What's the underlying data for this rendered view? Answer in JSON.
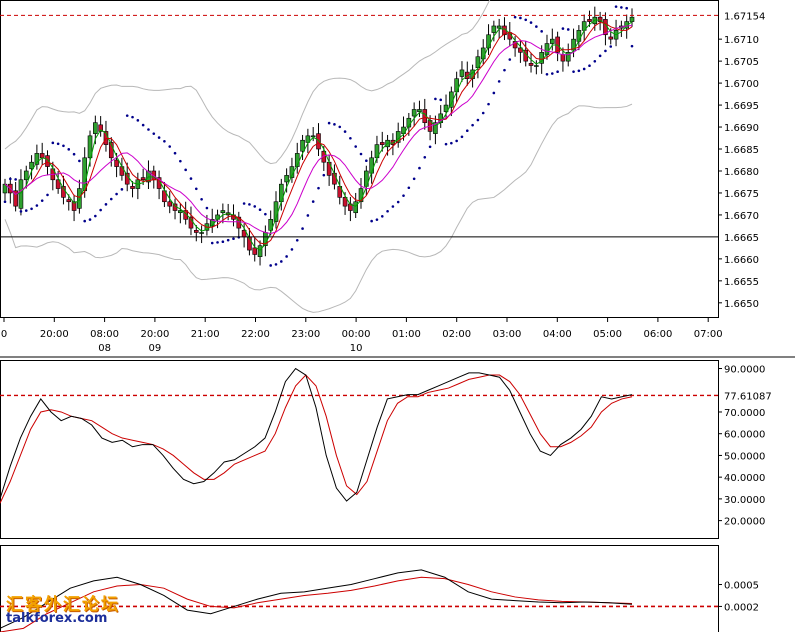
{
  "colors": {
    "bull_body": "#2ea02e",
    "bear_body": "#c8102e",
    "wick": "#000000",
    "bollinger": "#b8b8b8",
    "ma_fast": "#cc0000",
    "ma_slow": "#cc00cc",
    "ma_green": "#00a000",
    "sar": "#00008b",
    "hline": "#000000",
    "dashed_level": "#cc0000",
    "stoch_main": "#000000",
    "stoch_signal": "#cc0000",
    "level_text_blue": "#0000cc"
  },
  "logo": {
    "cn": "汇客外汇论坛",
    "en": "talkforex.com"
  },
  "chart_data": [
    {
      "type": "candlestick",
      "ylim": [
        1.6647,
        1.6718
      ],
      "price_ticks": [
        "1.6710",
        "1.6705",
        "1.6700",
        "1.6695",
        "1.6690",
        "1.6685",
        "1.6680",
        "1.6675",
        "1.6670",
        "1.6660",
        "1.6655",
        "1.6650"
      ],
      "current_price_label": "1.67154",
      "current_price": 1.67154,
      "horizontal_line_label": "1.6665",
      "horizontal_line": 1.6665,
      "time_labels": [
        {
          "t": "0",
          "d": ""
        },
        {
          "t": "20:00",
          "d": ""
        },
        {
          "t": "08:00",
          "d": "08"
        },
        {
          "t": "20:00",
          "d": "09"
        },
        {
          "t": "21:00",
          "d": ""
        },
        {
          "t": "22:00",
          "d": ""
        },
        {
          "t": "23:00",
          "d": ""
        },
        {
          "t": "00:00",
          "d": "10"
        },
        {
          "t": "01:00",
          "d": ""
        },
        {
          "t": "02:00",
          "d": ""
        },
        {
          "t": "03:00",
          "d": ""
        },
        {
          "t": "04:00",
          "d": ""
        },
        {
          "t": "05:00",
          "d": ""
        },
        {
          "t": "06:00",
          "d": ""
        },
        {
          "t": "07:00",
          "d": ""
        }
      ],
      "close": [
        1.6677,
        1.6675,
        1.6672,
        1.6678,
        1.668,
        1.6682,
        1.6684,
        1.6683,
        1.6681,
        1.6678,
        1.6676,
        1.6674,
        1.6673,
        1.6671,
        1.6676,
        1.6683,
        1.6688,
        1.6691,
        1.6689,
        1.6686,
        1.6683,
        1.6681,
        1.6679,
        1.6677,
        1.6676,
        1.6678,
        1.6678,
        1.668,
        1.6678,
        1.6676,
        1.6673,
        1.6672,
        1.6671,
        1.6671,
        1.6669,
        1.6667,
        1.6666,
        1.6666,
        1.6668,
        1.6669,
        1.667,
        1.6671,
        1.667,
        1.6669,
        1.6667,
        1.6665,
        1.6662,
        1.6661,
        1.6663,
        1.6666,
        1.6669,
        1.6673,
        1.6677,
        1.6679,
        1.6681,
        1.6684,
        1.6687,
        1.6688,
        1.6688,
        1.6685,
        1.6682,
        1.6679,
        1.6677,
        1.6674,
        1.6672,
        1.6671,
        1.6673,
        1.6676,
        1.668,
        1.6683,
        1.6686,
        1.6686,
        1.6687,
        1.6686,
        1.6689,
        1.669,
        1.6692,
        1.6694,
        1.6694,
        1.6691,
        1.6689,
        1.6691,
        1.6693,
        1.6695,
        1.6698,
        1.6701,
        1.6703,
        1.6701,
        1.6703,
        1.6706,
        1.6708,
        1.6711,
        1.6713,
        1.6713,
        1.6711,
        1.671,
        1.6708,
        1.6707,
        1.6705,
        1.6704,
        1.6704,
        1.6707,
        1.6709,
        1.671,
        1.6707,
        1.6705,
        1.6707,
        1.671,
        1.6712,
        1.6714,
        1.6714,
        1.6715,
        1.6714,
        1.6711,
        1.671,
        1.6712,
        1.6713,
        1.6714,
        1.6715
      ],
      "stochastic": {
        "yticks": [
          "90.0000",
          "70.0000",
          "60.0000",
          "50.0000",
          "40.0000",
          "30.0000",
          "20.0000"
        ],
        "ylim": [
          12,
          93
        ],
        "level_label": "77.61087",
        "level": 77.61087,
        "main": [
          30,
          45,
          58,
          68,
          76,
          70,
          66,
          68,
          67,
          64,
          58,
          56,
          57,
          54,
          55,
          55,
          50,
          44,
          39,
          37,
          38,
          42,
          47,
          48,
          51,
          54,
          58,
          70,
          84,
          90,
          87,
          72,
          50,
          35,
          29,
          33,
          48,
          63,
          76,
          77,
          78,
          78,
          80,
          82,
          84,
          86,
          88,
          88,
          87,
          86,
          80,
          70,
          60,
          52,
          50,
          55,
          58,
          62,
          68,
          77,
          76,
          77,
          78
        ],
        "signal": [
          28,
          38,
          50,
          62,
          70,
          71,
          70,
          68,
          67,
          66,
          63,
          60,
          58,
          57,
          56,
          55,
          53,
          50,
          46,
          42,
          39,
          39,
          42,
          46,
          48,
          50,
          52,
          60,
          72,
          82,
          87,
          82,
          68,
          50,
          36,
          32,
          38,
          52,
          66,
          74,
          77,
          77,
          79,
          80,
          81,
          83,
          85,
          86,
          87,
          87,
          84,
          78,
          69,
          60,
          54,
          54,
          56,
          59,
          63,
          70,
          74,
          76,
          77
        ]
      },
      "macd": {
        "yticks": [
          "0.0005",
          "0.0002"
        ],
        "ylim": [
          -0.00015,
          0.001
        ],
        "level_label": "0.0002",
        "level": 0.0002,
        "main": [
          -0.0001,
          5e-05,
          0.00025,
          0.00045,
          0.00055,
          0.0006,
          0.0005,
          0.00035,
          0.00015,
          0.0001,
          0.0002,
          0.0003,
          0.00038,
          0.0004,
          0.00045,
          0.0005,
          0.00058,
          0.00066,
          0.0007,
          0.0006,
          0.0004,
          0.0003,
          0.00028,
          0.00026,
          0.00025,
          0.00026,
          0.00025,
          0.00023
        ],
        "signal": [
          -0.00015,
          -0.0001,
          0.0001,
          0.00025,
          0.0004,
          0.00048,
          0.0005,
          0.00045,
          0.0003,
          0.0002,
          0.00018,
          0.00025,
          0.0003,
          0.00035,
          0.00038,
          0.00042,
          0.00048,
          0.00055,
          0.0006,
          0.00058,
          0.0005,
          0.0004,
          0.00033,
          0.00029,
          0.00027,
          0.00026,
          0.00025,
          0.00024
        ]
      }
    }
  ]
}
